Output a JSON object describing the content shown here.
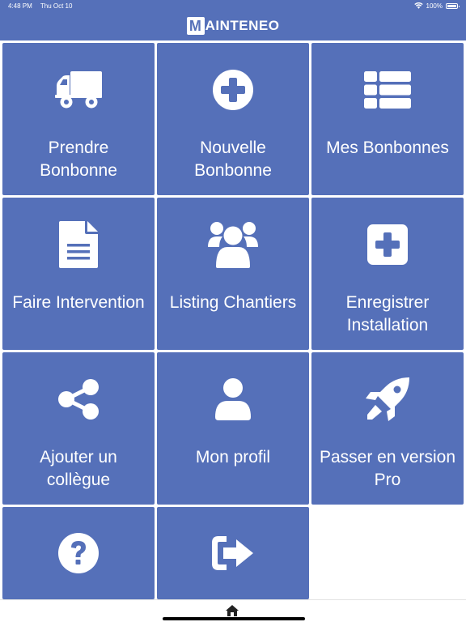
{
  "status_bar": {
    "time": "4:48 PM",
    "date": "Thu Oct 10",
    "battery": "100%",
    "battery_level": 1.0,
    "wifi_icon": "wifi-icon",
    "battery_icon": "battery-icon"
  },
  "header": {
    "logo_letter": "M",
    "logo_rest": "AINTENEO"
  },
  "colors": {
    "primary": "#5570b9",
    "background": "#ffffff",
    "text": "#ffffff"
  },
  "tiles": [
    {
      "label": "Prendre\nBonbonne",
      "icon": "truck-icon"
    },
    {
      "label": "Nouvelle\nBonbonne",
      "icon": "plus-circle-icon"
    },
    {
      "label": "Mes Bonbonnes",
      "icon": "list-icon"
    },
    {
      "label": "Faire Intervention",
      "icon": "document-icon"
    },
    {
      "label": "Listing Chantiers",
      "icon": "users-icon"
    },
    {
      "label": "Enregistrer\nInstallation",
      "icon": "plus-square-icon"
    },
    {
      "label": "Ajouter un\ncollègue",
      "icon": "share-icon"
    },
    {
      "label": "Mon profil",
      "icon": "user-icon"
    },
    {
      "label": "Passer en version\nPro",
      "icon": "rocket-icon"
    },
    {
      "label": "",
      "icon": "question-circle-icon"
    },
    {
      "label": "",
      "icon": "sign-out-icon"
    }
  ],
  "bottom_bar": {
    "home_icon": "home-icon"
  }
}
